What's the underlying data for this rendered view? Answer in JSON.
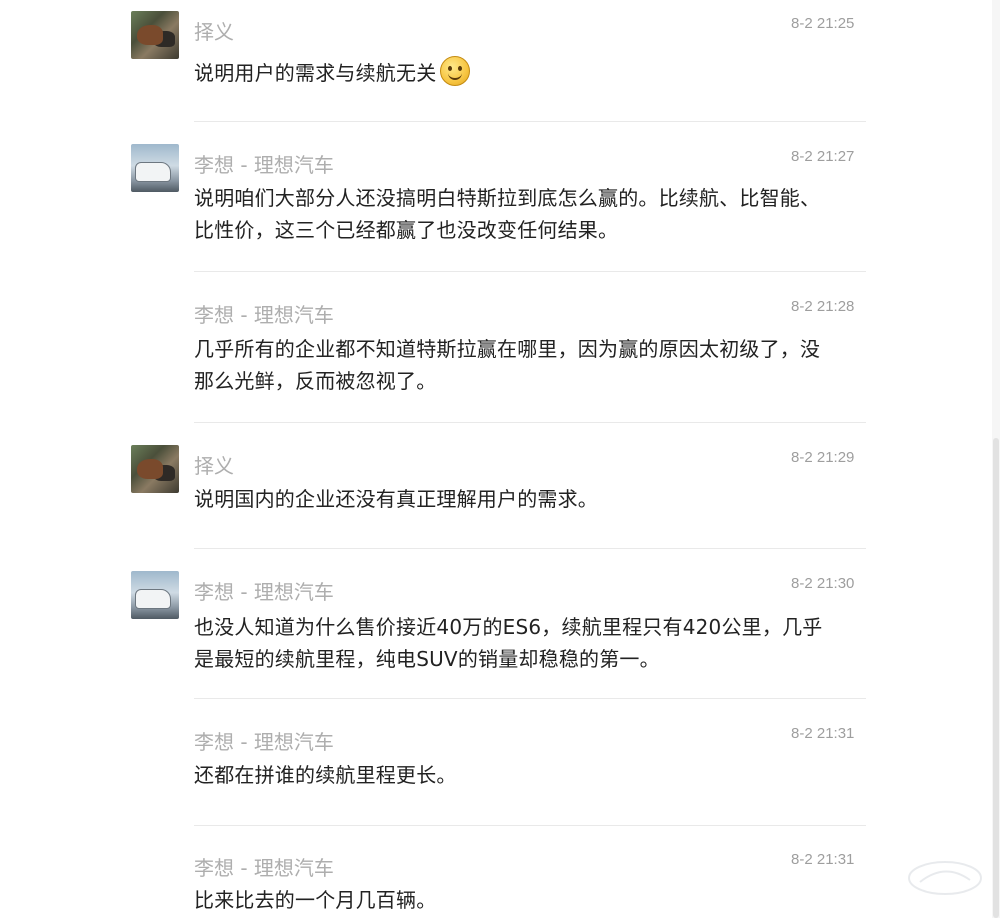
{
  "messages": [
    {
      "author": "择义",
      "avatar": "cattle-photo-avatar",
      "time": "8-2 21:25",
      "text": "说明用户的需求与续航无关",
      "emoji": "smiley-emoji-icon"
    },
    {
      "author": "李想 - 理想汽车",
      "avatar": "car-photo-avatar",
      "time": "8-2 21:27",
      "text": "说明咱们大部分人还没搞明白特斯拉到底怎么赢的。比续航、比智能、比性价，这三个已经都赢了也没改变任何结果。"
    },
    {
      "author": "李想 - 理想汽车",
      "avatar": null,
      "time": "8-2 21:28",
      "text": "几乎所有的企业都不知道特斯拉赢在哪里，因为赢的原因太初级了，没那么光鲜，反而被忽视了。"
    },
    {
      "author": "择义",
      "avatar": "cattle-photo-avatar",
      "time": "8-2 21:29",
      "text": "说明国内的企业还没有真正理解用户的需求。"
    },
    {
      "author": "李想 - 理想汽车",
      "avatar": "car-photo-avatar",
      "time": "8-2 21:30",
      "text": "也没人知道为什么售价接近40万的ES6，续航里程只有420公里，几乎是最短的续航里程，纯电SUV的销量却稳稳的第一。"
    },
    {
      "author": "李想 - 理想汽车",
      "avatar": null,
      "time": "8-2 21:31",
      "text": "还都在拼谁的续航里程更长。"
    },
    {
      "author": "李想 - 理想汽车",
      "avatar": null,
      "time": "8-2 21:31",
      "text": "比来比去的一个月几百辆。"
    }
  ],
  "colors": {
    "author": "#aeaeae",
    "time": "#9e9e9e",
    "text": "#222222",
    "divider": "#e9e9e9"
  }
}
